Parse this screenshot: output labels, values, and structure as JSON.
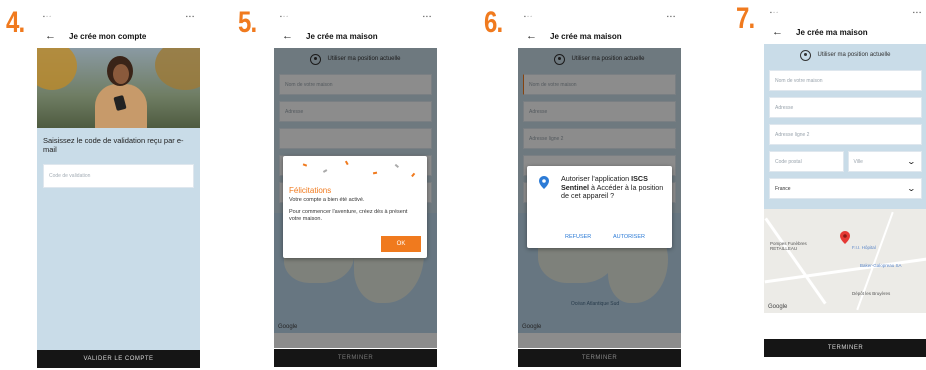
{
  "steps": [
    "4.",
    "5.",
    "6.",
    "7."
  ],
  "colors": {
    "accent": "#f07a1e",
    "form_bg": "#c9dce8",
    "footer_bg": "#151515",
    "link_blue": "#2c7bd6"
  },
  "screen4": {
    "title": "Je crée mon compte",
    "prompt": "Saisissez le code de validation reçu par e-mail",
    "code_placeholder": "Code de validation",
    "submit": "VALIDER LE COMPTE"
  },
  "screen5": {
    "title": "Je crée ma maison",
    "location": "Utiliser ma position actuelle",
    "fields": [
      "Nom de votre maison",
      "Adresse"
    ],
    "dialog": {
      "heading": "Félicitations",
      "line1": "Votre compte a bien été activé.",
      "line2": "Pour commencer l'aventure, créez dès à présent votre maison.",
      "ok": "OK"
    },
    "footer": "TERMINER",
    "map_logo": "Google"
  },
  "screen6": {
    "title": "Je crée ma maison",
    "location": "Utiliser ma position actuelle",
    "fields": [
      "Nom de votre maison",
      "Adresse",
      "Adresse ligne 2"
    ],
    "dialog": {
      "line1": "Autoriser l'application",
      "app": "ISCS Sentinel",
      "line2": " à Accéder à la position de cet appareil ?",
      "refuse": "REFUSER",
      "allow": "AUTORISER"
    },
    "map_labels": [
      "Océan Atlantique Sud"
    ],
    "footer": "TERMINER",
    "map_logo": "Google"
  },
  "screen7": {
    "title": "Je crée ma maison",
    "location": "Utiliser ma position actuelle",
    "fields": [
      "Nom de votre maison",
      "Adresse",
      "Adresse ligne 2"
    ],
    "postal": "Code postal",
    "city": "Ville",
    "country": "France",
    "map_labels": [
      "Pompes Funèbres RETAILLEAU",
      "F.I.I. Hôpital",
      "Baker-Galopreau SA",
      "Dépôt les Bruyères"
    ],
    "footer": "TERMINER",
    "map_logo": "Google"
  }
}
